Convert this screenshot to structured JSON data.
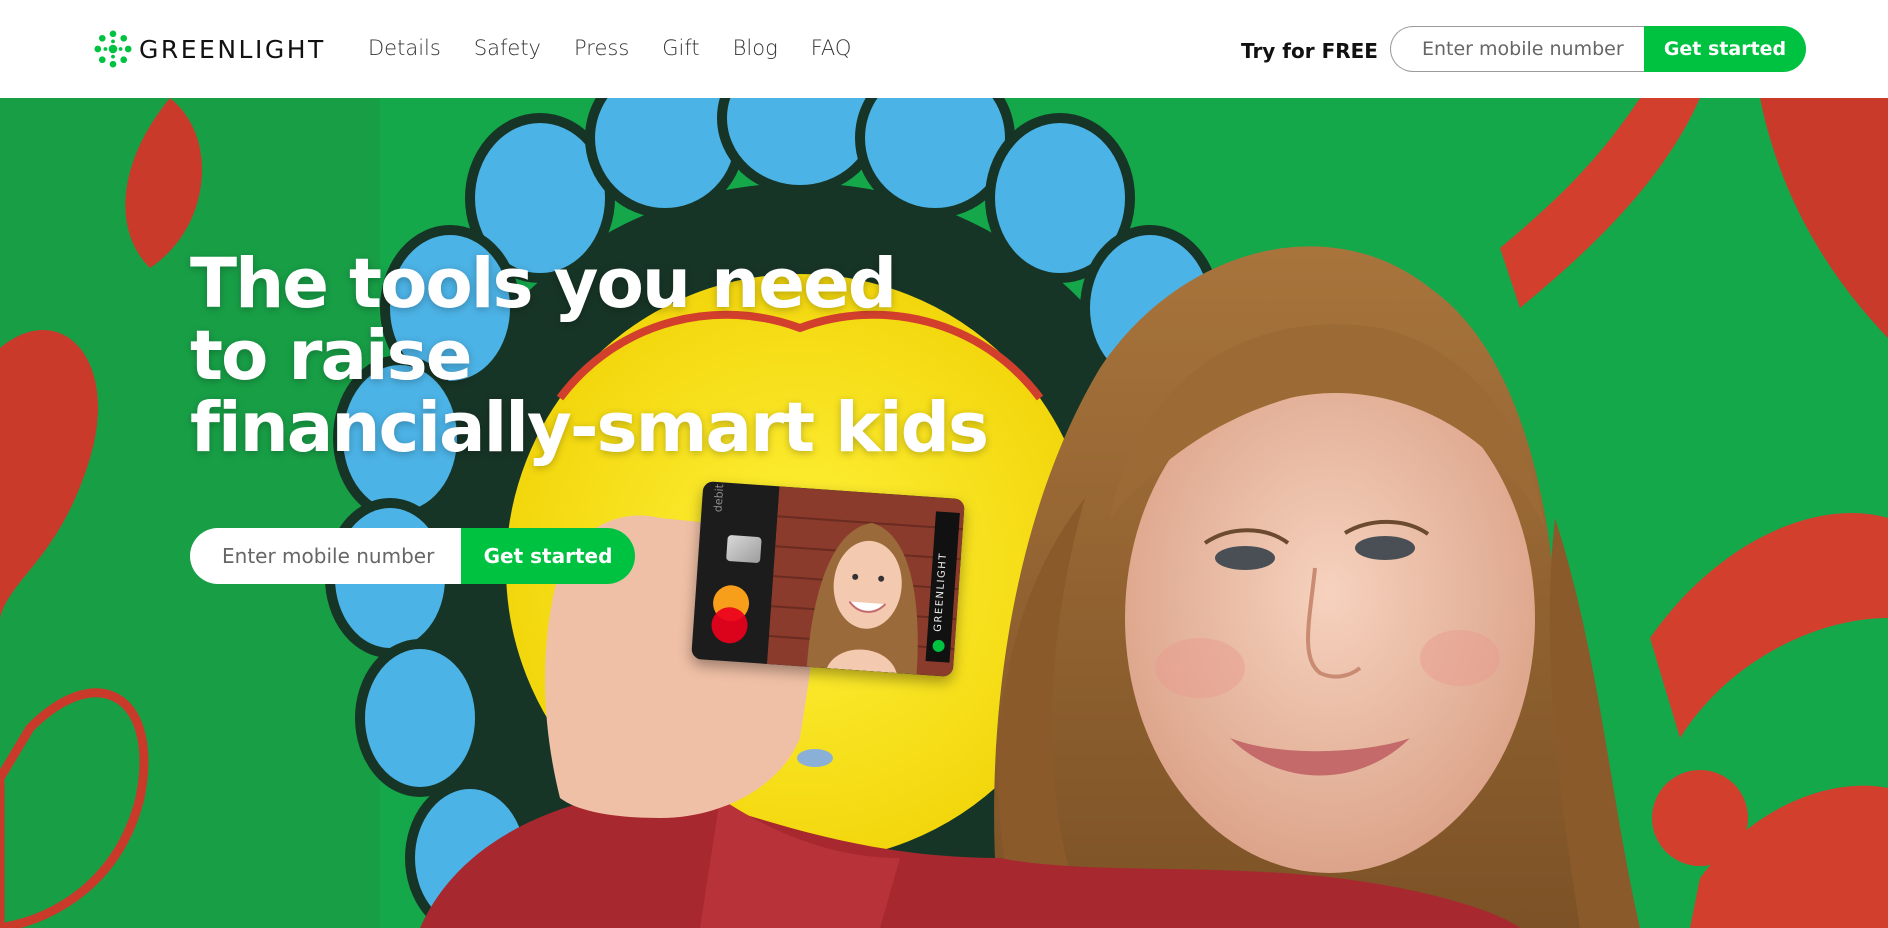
{
  "brand": {
    "name": "GREENLIGHT",
    "logo_icon": "greenlight-logo-icon",
    "accent_color": "#00c241"
  },
  "nav": {
    "links": [
      {
        "label": "Details"
      },
      {
        "label": "Safety"
      },
      {
        "label": "Press"
      },
      {
        "label": "Gift"
      },
      {
        "label": "Blog"
      },
      {
        "label": "FAQ"
      }
    ],
    "try_free": "Try for FREE",
    "signup": {
      "placeholder": "Enter mobile number",
      "button": "Get started"
    }
  },
  "hero": {
    "headline_lines": [
      "The tools you need",
      "to raise",
      "financially-smart kids"
    ],
    "signup": {
      "placeholder": "Enter mobile number",
      "button": "Get started"
    },
    "card": {
      "type_label": "debit",
      "brand_label": "GREENLIGHT",
      "network_icon": "mastercard-icon"
    }
  }
}
